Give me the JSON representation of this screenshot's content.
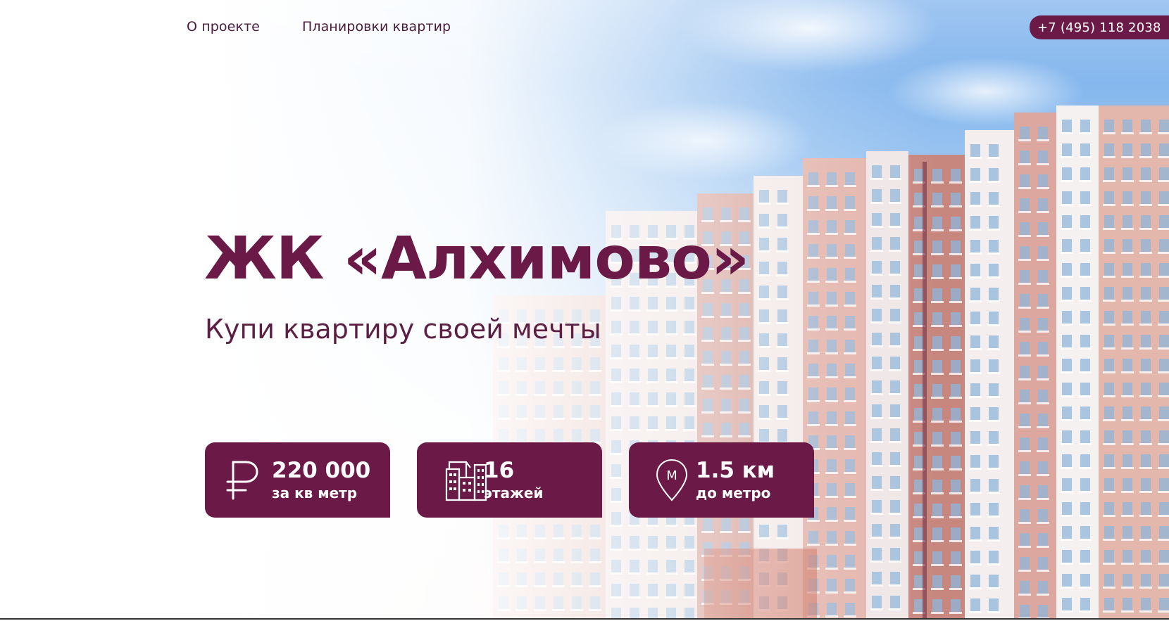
{
  "nav": {
    "items": [
      {
        "label": "О проекте"
      },
      {
        "label": "Планировки квартир"
      }
    ],
    "phone": "+7 (495) 118 2038"
  },
  "hero": {
    "title": "ЖК «Алхимово»",
    "subtitle": "Купи квартиру своей мечты"
  },
  "stats": [
    {
      "icon": "ruble-icon",
      "value": "220 000",
      "label": "за кв метр"
    },
    {
      "icon": "buildings-icon",
      "value": "16",
      "label": "этажей"
    },
    {
      "icon": "metro-pin-icon",
      "value": "1.5 км",
      "label": "до метро",
      "icon_text": "М"
    }
  ],
  "colors": {
    "brand": "#6b1a48",
    "text": "#4a1c3c",
    "sky": "#6fa9ea"
  }
}
